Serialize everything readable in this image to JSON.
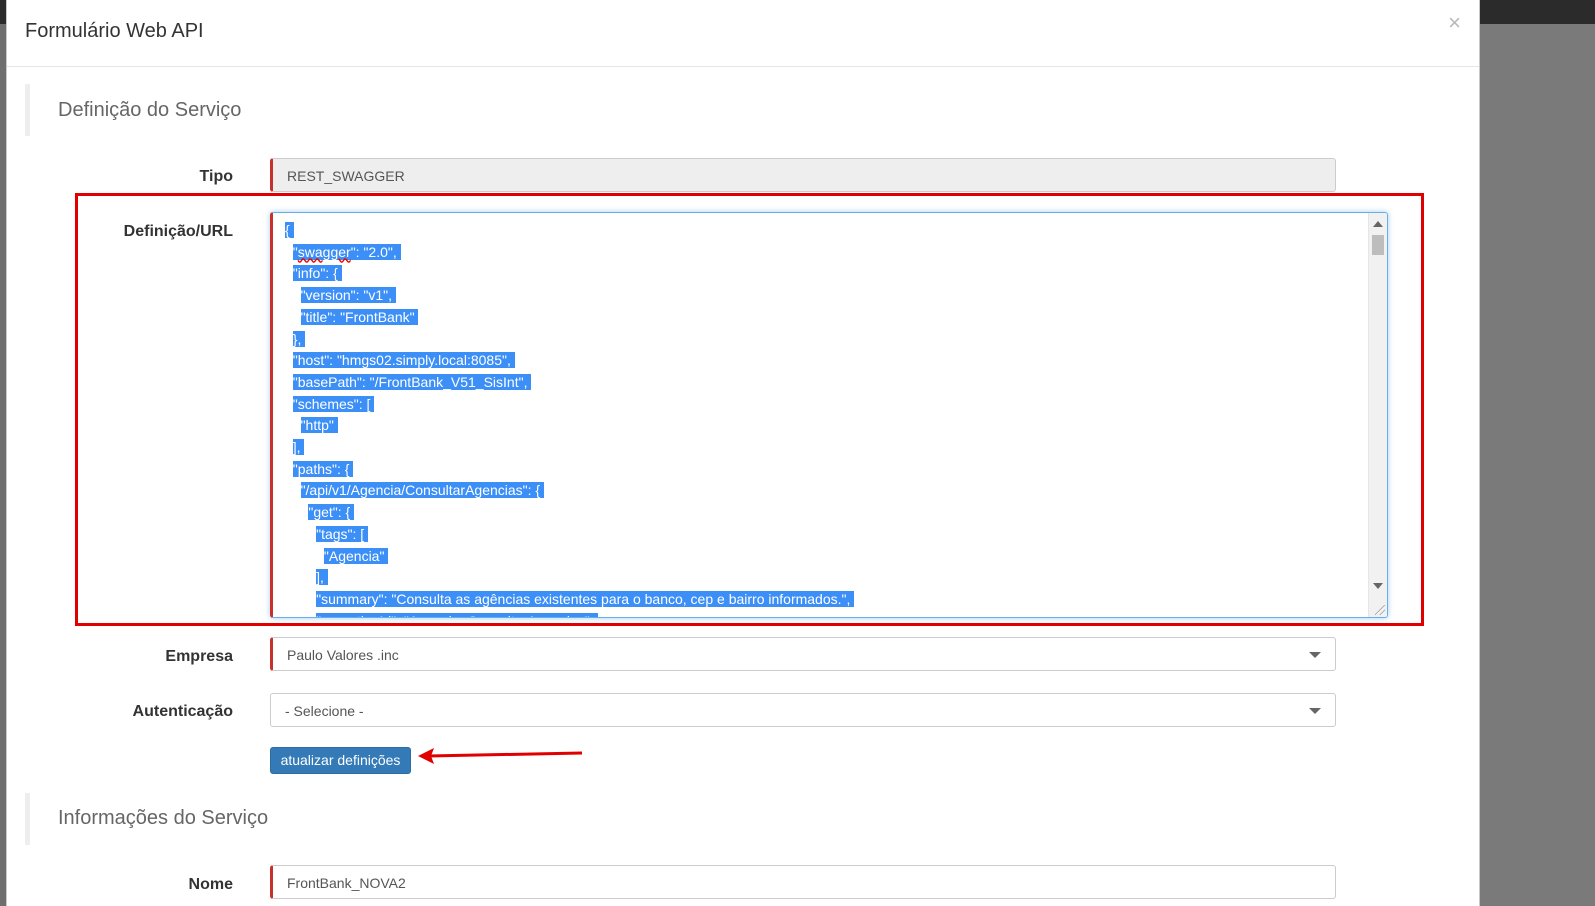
{
  "modal": {
    "title": "Formulário Web API",
    "close": "×"
  },
  "section1": {
    "title": "Definição do Serviço"
  },
  "tipo": {
    "label": "Tipo",
    "value": "REST_SWAGGER"
  },
  "definicao": {
    "label": "Definição/URL",
    "lines": [
      "{",
      "  \"swagger\": \"2.0\",",
      "  \"info\": {",
      "    \"version\": \"v1\",",
      "    \"title\": \"FrontBank\"",
      "  },",
      "  \"host\": \"hmgs02.simply.local:8085\",",
      "  \"basePath\": \"/FrontBank_V51_SisInt\",",
      "  \"schemes\": [",
      "    \"http\"",
      "  ],",
      "  \"paths\": {",
      "    \"/api/v1/Agencia/ConsultarAgencias\": {",
      "      \"get\": {",
      "        \"tags\": [",
      "          \"Agencia\"",
      "        ],",
      "        \"summary\": \"Consulta as agências existentes para o banco, cep e bairro informados.\",",
      "        \"operationId\": \"Agencia_ConsultarAgencias\","
    ]
  },
  "empresa": {
    "label": "Empresa",
    "value": "Paulo Valores .inc"
  },
  "autenticacao": {
    "label": "Autenticação",
    "value": "- Selecione -"
  },
  "update_button": {
    "label": "atualizar definições"
  },
  "section2": {
    "title": "Informações do Serviço"
  },
  "nome": {
    "label": "Nome",
    "value": "FrontBank_NOVA2"
  },
  "colors": {
    "annotation": "#e00000",
    "primary": "#337ab7",
    "selection": "#3b8ff6",
    "required": "#c9302c"
  }
}
